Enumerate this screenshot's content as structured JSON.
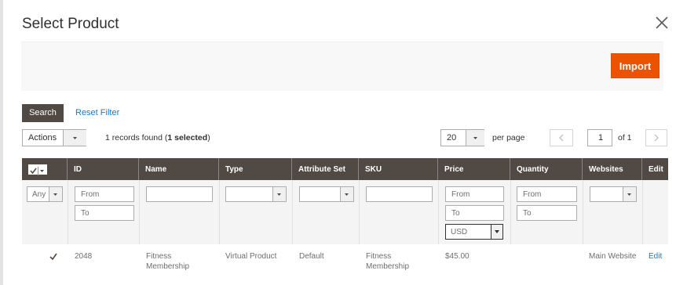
{
  "modal": {
    "title": "Select Product"
  },
  "toolbar": {
    "import_label": "Import"
  },
  "filters": {
    "search_label": "Search",
    "reset_label": "Reset Filter"
  },
  "grid_controls": {
    "actions_label": "Actions",
    "records_prefix": "1 records found (",
    "records_selected": "1 selected",
    "records_suffix": ")",
    "per_page_value": "20",
    "per_page_label": "per page",
    "page_value": "1",
    "page_of": "of 1"
  },
  "columns": [
    "ID",
    "Name",
    "Type",
    "Attribute Set",
    "SKU",
    "Price",
    "Quantity",
    "Websites",
    "Edit"
  ],
  "filter_row": {
    "any_label": "Any",
    "from": "From",
    "to": "To",
    "currency": "USD"
  },
  "rows": [
    {
      "checked": true,
      "id": "2048",
      "name_line1": "Fitness",
      "name_line2": "Membership",
      "type": "Virtual Product",
      "attribute_set": "Default",
      "sku_line1": "Fitness",
      "sku_line2": "Membership",
      "price": "$45.00",
      "quantity": "",
      "websites": "Main Website",
      "edit": "Edit"
    }
  ],
  "colors": {
    "accent": "#eb5202",
    "header": "#514943",
    "link": "#1979c3"
  }
}
